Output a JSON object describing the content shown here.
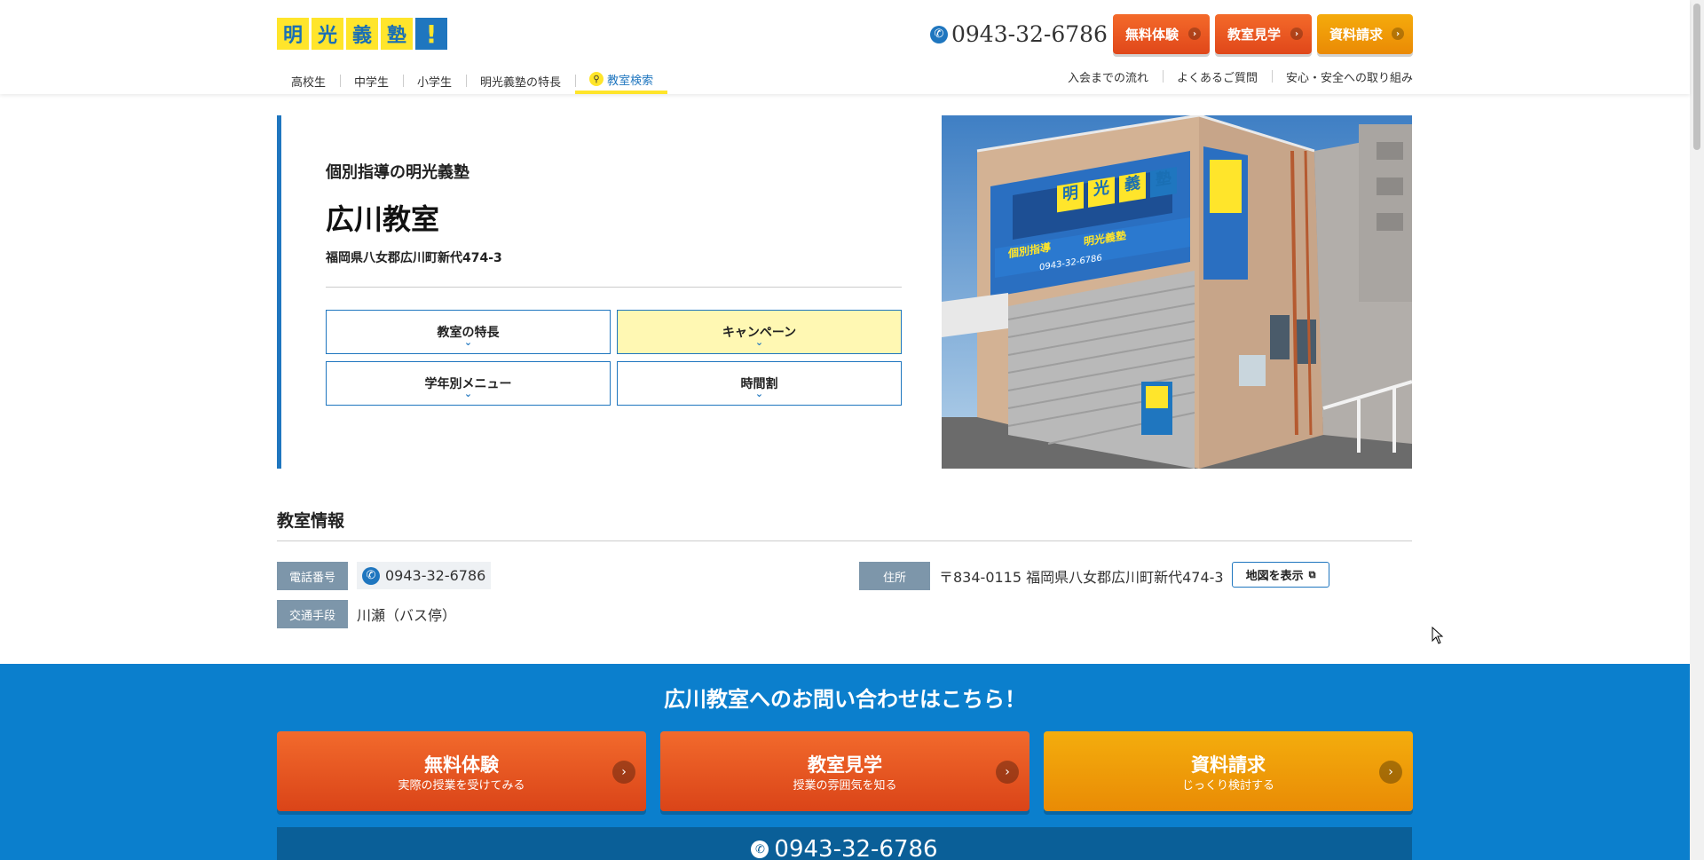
{
  "header": {
    "logo_chars": [
      "明",
      "光",
      "義",
      "塾",
      "!"
    ],
    "phone": "0943-32-6786",
    "buttons": [
      "無料体験",
      "教室見学",
      "資料請求"
    ],
    "nav_left": [
      "高校生",
      "中学生",
      "小学生",
      "明光義塾の特長",
      "教室検索"
    ],
    "nav_right": [
      "入会までの流れ",
      "よくあるご質問",
      "安心・安全への取り組み"
    ]
  },
  "hero": {
    "subtitle": "個別指導の明光義塾",
    "title": "広川教室",
    "address": "福岡県八女郡広川町新代474-3",
    "buttons": [
      "教室の特長",
      "キャンペーン",
      "学年別メニュー",
      "時間割"
    ],
    "photo_sign_text": [
      "明",
      "光",
      "義",
      "塾",
      "!",
      "個別指導",
      "明光義塾",
      "0943-32-6786"
    ]
  },
  "info": {
    "title": "教室情報",
    "phone_label": "電話番号",
    "phone_value": "0943-32-6786",
    "transport_label": "交通手段",
    "transport_value": "川瀬（バス停）",
    "address_label": "住所",
    "address_value": "〒834-0115 福岡県八女郡広川町新代474-3",
    "map_button": "地図を表示"
  },
  "cta": {
    "title": "広川教室へのお問い合わせはこちら！",
    "buttons": [
      {
        "label": "無料体験",
        "sub": "実際の授業を受けてみる"
      },
      {
        "label": "教室見学",
        "sub": "授業の雰囲気を知る"
      },
      {
        "label": "資料請求",
        "sub": "じっくり検討する"
      }
    ],
    "phone": "0943-32-6786"
  },
  "icons": {
    "phone": "phone-icon",
    "search": "search-icon",
    "arrow": "chevron-right-icon",
    "chevron_down": "chevron-down-icon",
    "external": "external-link-icon"
  },
  "colors": {
    "brand_blue": "#1f76bf",
    "brand_yellow": "#ffe52b",
    "cta_orange": "#e0471a",
    "cta_yellow": "#ea8a05",
    "cta_bg": "#0b7fcd"
  }
}
